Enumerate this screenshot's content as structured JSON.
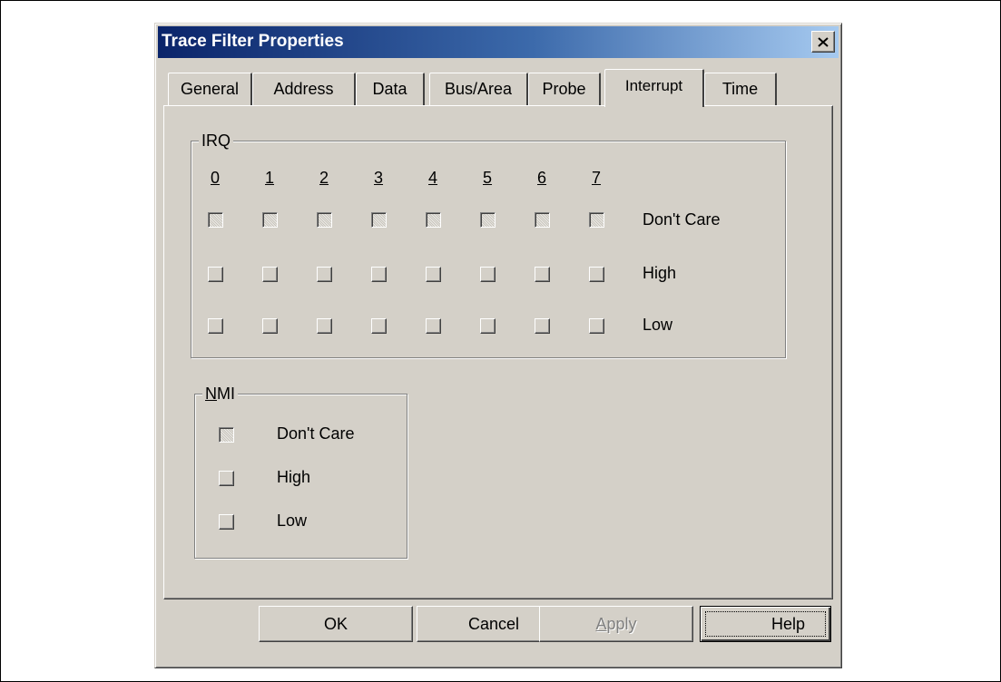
{
  "dialog": {
    "title": "Trace Filter Properties"
  },
  "tabs": [
    {
      "label": "General",
      "active": false
    },
    {
      "label": "Address",
      "active": false
    },
    {
      "label": "Data",
      "active": false
    },
    {
      "label": "Bus/Area",
      "active": false
    },
    {
      "label": "Probe",
      "active": false
    },
    {
      "label": "Interrupt",
      "active": true
    },
    {
      "label": "Time",
      "active": false
    }
  ],
  "irq": {
    "legend": "IRQ",
    "columns": [
      "0",
      "1",
      "2",
      "3",
      "4",
      "5",
      "6",
      "7"
    ],
    "rows": [
      {
        "label": "Don't Care",
        "state": "indeterminate"
      },
      {
        "label": "High",
        "state": "unchecked"
      },
      {
        "label": "Low",
        "state": "unchecked"
      }
    ]
  },
  "nmi": {
    "legend_mnemonic": "N",
    "legend_rest": "MI",
    "rows": [
      {
        "label": "Don't Care",
        "state": "indeterminate"
      },
      {
        "label": "High",
        "state": "unchecked"
      },
      {
        "label": "Low",
        "state": "unchecked"
      }
    ]
  },
  "buttons": {
    "ok": "OK",
    "cancel": "Cancel",
    "apply_mnemonic": "A",
    "apply_rest": "pply",
    "apply_enabled": false,
    "help": "Help"
  },
  "icons": {
    "close": "close-icon"
  },
  "colors": {
    "face": "#d4d0c8",
    "title_start": "#0a246a",
    "title_end": "#a6caf0"
  }
}
